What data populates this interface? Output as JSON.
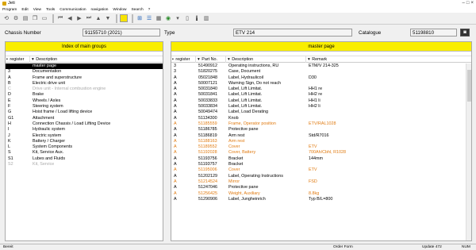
{
  "window": {
    "title": "Jeti"
  },
  "menu": [
    "Program",
    "Edit",
    "View",
    "Tools",
    "Communication",
    "navigation",
    "Window",
    "Search",
    "?"
  ],
  "header": {
    "chassis_label": "Chassis Number",
    "chassis_value": "91155710  (2021)",
    "type_label": "Type",
    "type_value": "ETV 214",
    "catalogue_label": "Catalogue",
    "catalogue_value": "51198810"
  },
  "left_panel": {
    "title": "Index of main groups",
    "col_register": "register",
    "col_description": "Description",
    "rows": [
      {
        "reg": "",
        "desc": "master page",
        "state": "sel"
      },
      {
        "reg": "3",
        "desc": "Documentation",
        "state": ""
      },
      {
        "reg": "A",
        "desc": "Frame and superstructure",
        "state": ""
      },
      {
        "reg": "B",
        "desc": "Electric drive unit",
        "state": ""
      },
      {
        "reg": "C",
        "desc": "Drive unit - Internal combustion engine",
        "state": "gray"
      },
      {
        "reg": "D",
        "desc": "Brake",
        "state": ""
      },
      {
        "reg": "E",
        "desc": "Wheels / Axles",
        "state": ""
      },
      {
        "reg": "F",
        "desc": "Steering system",
        "state": ""
      },
      {
        "reg": "G",
        "desc": "Hoist frame / Load lifting device",
        "state": ""
      },
      {
        "reg": "G1",
        "desc": "Attachment",
        "state": ""
      },
      {
        "reg": "H",
        "desc": "Connection Chassis / Load Lifting Device",
        "state": ""
      },
      {
        "reg": "I",
        "desc": "Hydraulic system",
        "state": ""
      },
      {
        "reg": "J",
        "desc": "Electric system",
        "state": ""
      },
      {
        "reg": "K",
        "desc": "Battery / Charger",
        "state": ""
      },
      {
        "reg": "L",
        "desc": "System Components",
        "state": ""
      },
      {
        "reg": "S",
        "desc": "Kit, Service Aux.",
        "state": ""
      },
      {
        "reg": "S1",
        "desc": "Lubes and Fluids",
        "state": ""
      },
      {
        "reg": "S2",
        "desc": "Kit, Service",
        "state": "gray"
      }
    ]
  },
  "right_panel": {
    "title": "master page",
    "col_register": "register",
    "col_part": "Part No.",
    "col_description": "Description",
    "col_remark": "Remark",
    "rows": [
      {
        "reg": "3",
        "part": "51490912",
        "desc": "Operating instructions, RU",
        "remark": "ETM/V 214-325",
        "state": ""
      },
      {
        "reg": "3",
        "part": "51820275",
        "desc": "Case, Document",
        "remark": "",
        "state": ""
      },
      {
        "reg": "A",
        "part": "05021848",
        "desc": "Label, Hydraulicoil",
        "remark": "D30",
        "state": ""
      },
      {
        "reg": "A",
        "part": "50007121",
        "desc": "Warning Sign, Do not reach",
        "remark": "",
        "state": ""
      },
      {
        "reg": "A",
        "part": "50031840",
        "desc": "Label, Lift  Limitat.",
        "remark": "HH1 re",
        "state": ""
      },
      {
        "reg": "A",
        "part": "50031841",
        "desc": "Label, Lift  Limitat.",
        "remark": "HH2 re",
        "state": ""
      },
      {
        "reg": "A",
        "part": "50033833",
        "desc": "Label, Lift  Limitat.",
        "remark": "HH1 li",
        "state": ""
      },
      {
        "reg": "A",
        "part": "50033834",
        "desc": "Label, Lift  Limitat.",
        "remark": "HH2 li",
        "state": ""
      },
      {
        "reg": "A",
        "part": "50049474",
        "desc": "Label, Load Derating",
        "remark": "",
        "state": ""
      },
      {
        "reg": "A",
        "part": "51134300",
        "desc": "Knob",
        "remark": "",
        "state": ""
      },
      {
        "reg": "A",
        "part": "51185559",
        "desc": "Frame, Operator position",
        "remark": "ETV/RAL1028",
        "state": "orange"
      },
      {
        "reg": "A",
        "part": "51186785",
        "desc": "Protective pane",
        "remark": "",
        "state": ""
      },
      {
        "reg": "A",
        "part": "51186819",
        "desc": "Arm rest",
        "remark": "Std/R7016",
        "state": ""
      },
      {
        "reg": "A",
        "part": "51188163",
        "desc": "Arm rest",
        "remark": "",
        "state": "orange"
      },
      {
        "reg": "A",
        "part": "51189552",
        "desc": "Cover",
        "remark": "ETV",
        "state": "orange"
      },
      {
        "reg": "A",
        "part": "51192028",
        "desc": "Cover, Battery",
        "remark": "700Ah/Cbhl, R1028",
        "state": "orange"
      },
      {
        "reg": "A",
        "part": "51193756",
        "desc": "Bracket",
        "remark": "144mm",
        "state": ""
      },
      {
        "reg": "A",
        "part": "51193757",
        "desc": "Bracket",
        "remark": "",
        "state": ""
      },
      {
        "reg": "A",
        "part": "51195006",
        "desc": "Cover",
        "remark": "ETV",
        "state": "orange"
      },
      {
        "reg": "A",
        "part": "51202129",
        "desc": "Label, Operating Instructions",
        "remark": "",
        "state": ""
      },
      {
        "reg": "A",
        "part": "51214524",
        "desc": "Mirror",
        "remark": "FSD",
        "state": "orange"
      },
      {
        "reg": "A",
        "part": "51247046",
        "desc": "Protective pane",
        "remark": "",
        "state": ""
      },
      {
        "reg": "A",
        "part": "51256425",
        "desc": "Weight, Auxiliary",
        "remark": "8.8kg",
        "state": "orange"
      },
      {
        "reg": "A",
        "part": "51290906",
        "desc": "Label, Jungheinrich",
        "remark": "Typ B/L=800",
        "state": ""
      }
    ]
  },
  "status": {
    "left": "Bereit",
    "middle": "Order Form",
    "update": "Update 472",
    "right": "NUM"
  }
}
